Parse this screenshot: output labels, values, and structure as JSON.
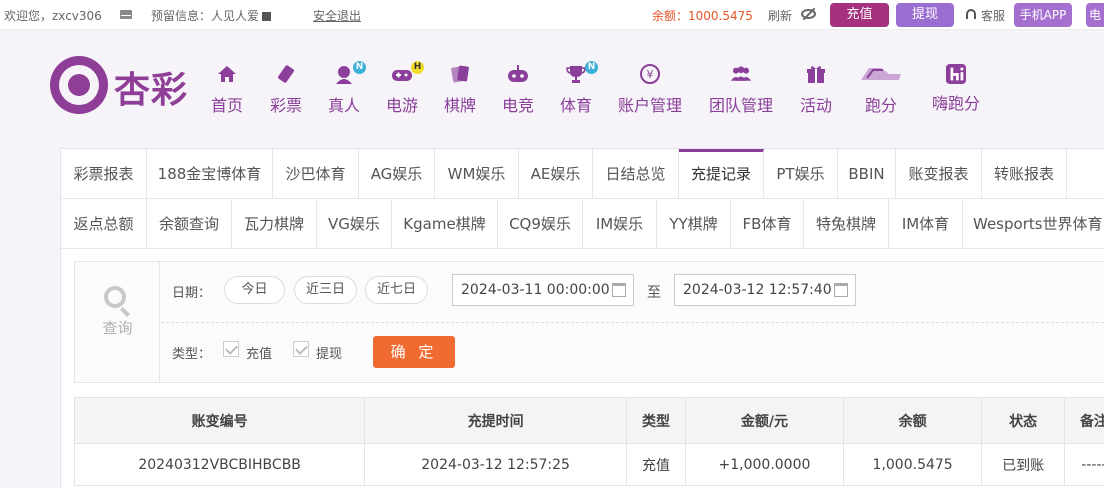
{
  "topbar": {
    "welcome": "欢迎您，zxcv306",
    "reserve_info": "预留信息：人见人爱",
    "logout": "安全退出",
    "balance": "余额：1000.5475",
    "refresh": "刷新",
    "recharge": "充值",
    "withdraw": "提现",
    "service": "客服",
    "app": "手机APP",
    "extra": "电"
  },
  "brand": {
    "name": "杏彩"
  },
  "nav": [
    {
      "label": "首页",
      "icon": "home-icon"
    },
    {
      "label": "彩票",
      "icon": "lottery-ticket-icon"
    },
    {
      "label": "真人",
      "icon": "live-dealer-icon",
      "badge": "N"
    },
    {
      "label": "电游",
      "icon": "gamepad-icon",
      "badge": "H"
    },
    {
      "label": "棋牌",
      "icon": "cards-icon"
    },
    {
      "label": "电竞",
      "icon": "controller-icon"
    },
    {
      "label": "体育",
      "icon": "trophy-icon",
      "badge": "N"
    },
    {
      "label": "账户管理",
      "icon": "yen-coin-icon"
    },
    {
      "label": "团队管理",
      "icon": "team-icon"
    },
    {
      "label": "活动",
      "icon": "gift-icon"
    },
    {
      "label": "跑分",
      "icon": "running-icon"
    },
    {
      "label": "嗨跑分",
      "icon": "hi-icon"
    }
  ],
  "tabs_row1": [
    "彩票报表",
    "188金宝博体育",
    "沙巴体育",
    "AG娱乐",
    "WM娱乐",
    "AE娱乐",
    "日结总览",
    "充提记录",
    "PT娱乐",
    "BBIN",
    "账变报表",
    "转账报表"
  ],
  "tabs_row2": [
    "返点总额",
    "余额查询",
    "瓦力棋牌",
    "VG娱乐",
    "Kgame棋牌",
    "CQ9娱乐",
    "IM娱乐",
    "YY棋牌",
    "FB体育",
    "特兔棋牌",
    "IM体育",
    "Wesports世界体育"
  ],
  "active_tab": "充提记录",
  "filter": {
    "query_label": "查询",
    "date_label": "日期：",
    "quick_ranges": [
      "今日",
      "近三日",
      "近七日"
    ],
    "start_date": "2024-03-11 00:00:00",
    "to_label": "至",
    "end_date": "2024-03-12 12:57:40",
    "type_label": "类型：",
    "types": [
      "充值",
      "提现"
    ],
    "confirm": "确 定"
  },
  "table": {
    "headers": [
      "账变编号",
      "充提时间",
      "类型",
      "金额/元",
      "余额",
      "状态",
      "备注"
    ],
    "rows": [
      [
        "20240312VBCBIHBCBB",
        "2024-03-12 12:57:25",
        "充值",
        "+1,000.0000",
        "1,000.5475",
        "已到账",
        "-----"
      ]
    ]
  },
  "colors": {
    "brand": "#8b3f9a",
    "recharge_btn": "#a4307e",
    "confirm_btn": "#f06b31",
    "amount": "#e0242a",
    "status_ok": "#2e9e2e"
  }
}
